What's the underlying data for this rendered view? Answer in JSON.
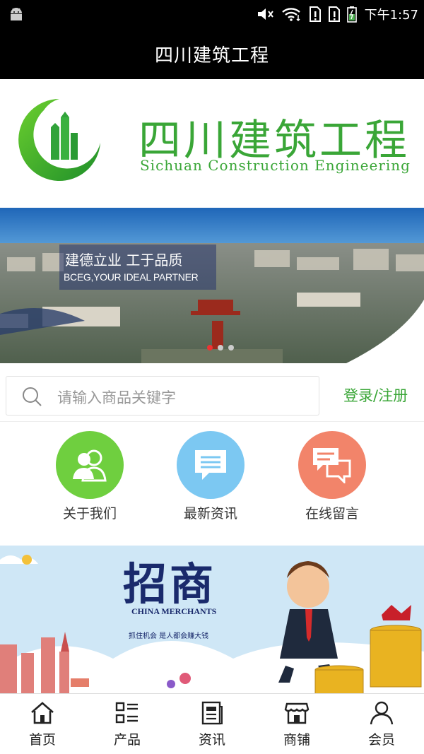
{
  "status_bar": {
    "time": "下午1:57"
  },
  "header": {
    "title": "四川建筑工程"
  },
  "logo": {
    "name_cn": "四川建筑工程",
    "name_en": "Sichuan Construction Engineering"
  },
  "hero": {
    "caption_cn": "建德立业  工于品质",
    "caption_en": "BCEG,YOUR IDEAL PARTNER",
    "active_slide": 1,
    "slide_count": 3
  },
  "search": {
    "placeholder": "请输入商品关键字",
    "login_label": "登录/注册"
  },
  "quick_nav": [
    {
      "label": "关于我们",
      "icon": "users-icon",
      "color": "#6fcf3f"
    },
    {
      "label": "最新资讯",
      "icon": "news-icon",
      "color": "#7cc8f2"
    },
    {
      "label": "在线留言",
      "icon": "chat-icon",
      "color": "#f2846a"
    }
  ],
  "promo": {
    "title": "招商",
    "subtitle": "CHINA MERCHANTS",
    "slogan": "抓住机会 是人都会赚大钱"
  },
  "bottom_nav": [
    {
      "label": "首页",
      "icon": "home-icon"
    },
    {
      "label": "产品",
      "icon": "product-grid-icon"
    },
    {
      "label": "资讯",
      "icon": "news-doc-icon"
    },
    {
      "label": "商铺",
      "icon": "shop-icon"
    },
    {
      "label": "会员",
      "icon": "member-icon"
    }
  ],
  "colors": {
    "brand_green": "#3aa637",
    "bar_black": "#000000"
  }
}
